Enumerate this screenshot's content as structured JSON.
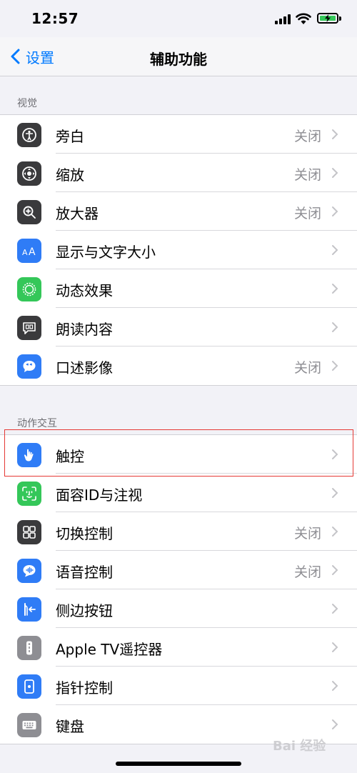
{
  "status_bar": {
    "time": "12:57"
  },
  "nav": {
    "back_label": "设置",
    "title": "辅助功能"
  },
  "sections": [
    {
      "header": "视觉",
      "items": [
        {
          "label": "旁白",
          "value": "关闭",
          "icon": "voiceover-icon",
          "color": "#3a3a3c"
        },
        {
          "label": "缩放",
          "value": "关闭",
          "icon": "zoom-icon",
          "color": "#3a3a3c"
        },
        {
          "label": "放大器",
          "value": "关闭",
          "icon": "magnifier-icon",
          "color": "#3a3a3c"
        },
        {
          "label": "显示与文字大小",
          "value": "",
          "icon": "text-size-icon",
          "color": "#2f7cf6"
        },
        {
          "label": "动态效果",
          "value": "",
          "icon": "motion-icon",
          "color": "#34c759"
        },
        {
          "label": "朗读内容",
          "value": "",
          "icon": "spoken-content-icon",
          "color": "#3a3a3c"
        },
        {
          "label": "口述影像",
          "value": "关闭",
          "icon": "audio-description-icon",
          "color": "#2f7cf6"
        }
      ]
    },
    {
      "header": "动作交互",
      "items": [
        {
          "label": "触控",
          "value": "",
          "icon": "touch-icon",
          "color": "#2f7cf6"
        },
        {
          "label": "面容ID与注视",
          "value": "",
          "icon": "face-id-icon",
          "color": "#34c759"
        },
        {
          "label": "切换控制",
          "value": "关闭",
          "icon": "switch-control-icon",
          "color": "#3a3a3c"
        },
        {
          "label": "语音控制",
          "value": "关闭",
          "icon": "voice-control-icon",
          "color": "#2f7cf6"
        },
        {
          "label": "侧边按钮",
          "value": "",
          "icon": "side-button-icon",
          "color": "#2f7cf6"
        },
        {
          "label": "Apple TV遥控器",
          "value": "",
          "icon": "remote-icon",
          "color": "#8e8e93"
        },
        {
          "label": "指针控制",
          "value": "",
          "icon": "pointer-control-icon",
          "color": "#2f7cf6"
        },
        {
          "label": "键盘",
          "value": "",
          "icon": "keyboard-icon",
          "color": "#8e8e93"
        }
      ]
    }
  ],
  "colors": {
    "accent": "#007aff",
    "highlight": "#e53935"
  },
  "watermark": "Bai 经验"
}
